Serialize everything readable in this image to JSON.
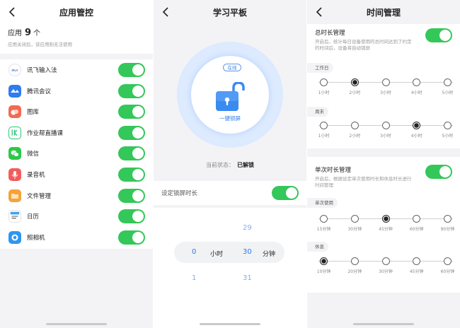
{
  "panel1": {
    "title": "应用管控",
    "count_prefix": "应用",
    "count": "9",
    "count_suffix": "个",
    "hint": "应用关闭后，该应用则无法使用",
    "apps": [
      {
        "name": "讯飞输入法",
        "icon": "ifly-input-icon",
        "color": "#ffffff"
      },
      {
        "name": "腾讯会议",
        "icon": "tencent-meeting-icon",
        "color": "#2f7bf2"
      },
      {
        "name": "图库",
        "icon": "gallery-icon",
        "color": "#f26a52"
      },
      {
        "name": "作业帮直播课",
        "icon": "zuoyebang-icon",
        "color": "#2cc57a"
      },
      {
        "name": "微信",
        "icon": "wechat-icon",
        "color": "#2bc84a"
      },
      {
        "name": "录音机",
        "icon": "recorder-icon",
        "color": "#f25c5c"
      },
      {
        "name": "文件管理",
        "icon": "file-manager-icon",
        "color": "#f5a23a"
      },
      {
        "name": "日历",
        "icon": "calendar-icon",
        "color": "#3aa2f0"
      },
      {
        "name": "照相机",
        "icon": "camera-icon",
        "color": "#2f96ef"
      }
    ]
  },
  "panel2": {
    "title": "学习平板",
    "status_chip": "在线",
    "unlock_label": "一键锁屏",
    "cur_state_label": "当前状态：",
    "cur_state_value": "已解锁",
    "set_duration_label": "设定锁屏时长",
    "picker": {
      "hour_prev": "",
      "hour": "0",
      "hour_next": "1",
      "hour_unit": "小时",
      "min_prev": "29",
      "min": "30",
      "min_next": "31",
      "min_unit": "分钟"
    }
  },
  "panel3": {
    "title": "时间管理",
    "total": {
      "title": "总时长管理",
      "desc": "开启后，统计每日设备使用的总时间达到了约定的时间后，设备将自动锁屏"
    },
    "workday": {
      "label": "工作日",
      "ticks": [
        "1小时",
        "2小时",
        "3小时",
        "4小时",
        "5小时"
      ],
      "selected": 1
    },
    "weekend": {
      "label": "周末",
      "ticks": [
        "1小时",
        "2小时",
        "3小时",
        "4小时",
        "5小时"
      ],
      "selected": 3
    },
    "single": {
      "title": "单次时长管理",
      "desc": "开启后，根据设定单次使用时长和休息时长进行时间管理"
    },
    "single_use": {
      "label": "单次使用",
      "ticks": [
        "15分钟",
        "30分钟",
        "45分钟",
        "60分钟",
        "90分钟"
      ],
      "selected": 2
    },
    "rest": {
      "label": "休息",
      "ticks": [
        "10分钟",
        "20分钟",
        "30分钟",
        "45分钟",
        "60分钟"
      ],
      "selected": 0
    }
  },
  "colors": {
    "toggle_on": "#34c759",
    "accent_blue": "#2f7bea"
  }
}
